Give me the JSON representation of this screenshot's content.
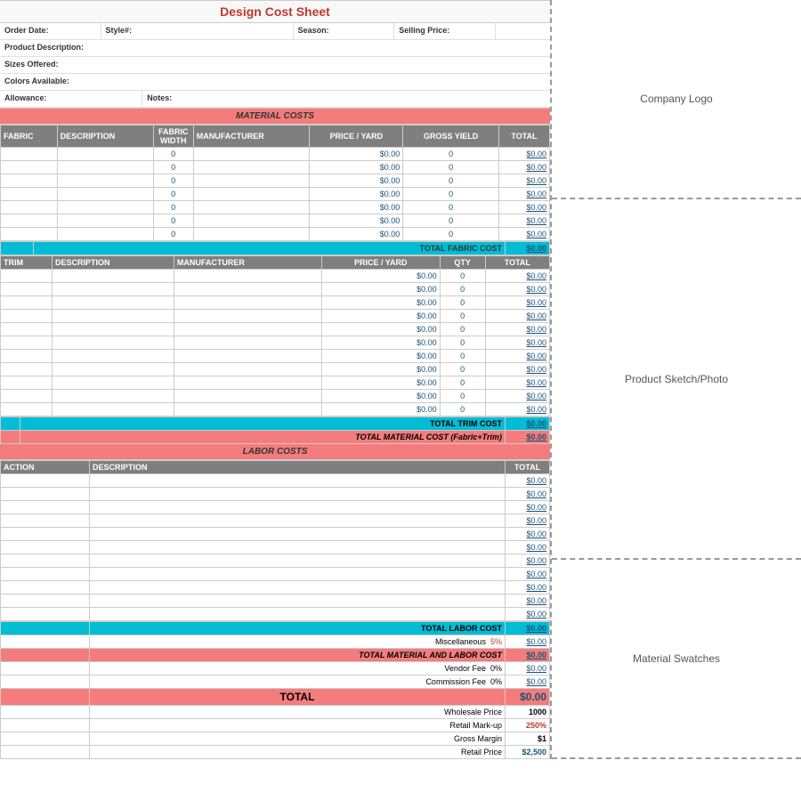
{
  "title": "Design Cost Sheet",
  "info": {
    "order_date_label": "Order Date:",
    "style_label": "Style#:",
    "season_label": "Season:",
    "selling_price_label": "Selling Price:",
    "product_desc_label": "Product Description:",
    "sizes_label": "Sizes Offered:",
    "colors_label": "Colors Available:",
    "allowance_label": "Allowance:",
    "notes_label": "Notes:"
  },
  "material_costs_header": "MATERIAL COSTS",
  "fabric_headers": [
    "FABRIC",
    "DESCRIPTION",
    "FABRIC WIDTH",
    "MANUFACTURER",
    "PRICE / YARD",
    "GROSS YIELD",
    "TOTAL"
  ],
  "fabric_rows": [
    {
      "price": "$0.00",
      "yield": "0",
      "total": "$0.00"
    },
    {
      "price": "$0.00",
      "yield": "0",
      "total": "$0.00"
    },
    {
      "price": "$0.00",
      "yield": "0",
      "total": "$0.00"
    },
    {
      "price": "$0.00",
      "yield": "0",
      "total": "$0.00"
    },
    {
      "price": "$0.00",
      "yield": "0",
      "total": "$0.00"
    },
    {
      "price": "$0.00",
      "yield": "0",
      "total": "$0.00"
    },
    {
      "price": "$0.00",
      "yield": "0",
      "total": "$0.00"
    }
  ],
  "total_fabric_label": "TOTAL FABRIC COST",
  "total_fabric_value": "$0.00",
  "trim_headers": [
    "TRIM",
    "DESCRIPTION",
    "MANUFACTURER",
    "PRICE / YARD",
    "QTY",
    "TOTAL"
  ],
  "trim_rows": [
    {
      "price": "$0.00",
      "qty": "0",
      "total": "$0.00"
    },
    {
      "price": "$0.00",
      "qty": "0",
      "total": "$0.00"
    },
    {
      "price": "$0.00",
      "qty": "0",
      "total": "$0.00"
    },
    {
      "price": "$0.00",
      "qty": "0",
      "total": "$0.00"
    },
    {
      "price": "$0.00",
      "qty": "0",
      "total": "$0.00"
    },
    {
      "price": "$0.00",
      "qty": "0",
      "total": "$0.00"
    },
    {
      "price": "$0.00",
      "qty": "0",
      "total": "$0.00"
    },
    {
      "price": "$0.00",
      "qty": "0",
      "total": "$0.00"
    },
    {
      "price": "$0.00",
      "qty": "0",
      "total": "$0.00"
    },
    {
      "price": "$0.00",
      "qty": "0",
      "total": "$0.00"
    },
    {
      "price": "$0.00",
      "qty": "0",
      "total": "$0.00"
    }
  ],
  "total_trim_label": "TOTAL TRIM COST",
  "total_trim_value": "$0.00",
  "total_material_label": "TOTAL MATERIAL COST (Fabric+Trim)",
  "total_material_value": "$0.00",
  "labor_costs_header": "LABOR COSTS",
  "labor_headers": [
    "ACTION",
    "DESCRIPTION",
    "TOTAL"
  ],
  "labor_rows": [
    {
      "total": "$0.00"
    },
    {
      "total": "$0.00"
    },
    {
      "total": "$0.00"
    },
    {
      "total": "$0.00"
    },
    {
      "total": "$0.00"
    },
    {
      "total": "$0.00"
    },
    {
      "total": "$0.00"
    },
    {
      "total": "$0.00"
    },
    {
      "total": "$0.00"
    },
    {
      "total": "$0.00"
    },
    {
      "total": "$0.00"
    }
  ],
  "total_labor_label": "TOTAL LABOR COST",
  "total_labor_value": "$0.00",
  "misc_label": "Miscellaneous",
  "misc_pct": "5%",
  "misc_value": "$0.00",
  "total_mat_labor_label": "TOTAL MATERIAL AND LABOR COST",
  "total_mat_labor_value": "$0.00",
  "vendor_fee_label": "Vendor Fee",
  "vendor_fee_pct": "0%",
  "vendor_fee_value": "$0.00",
  "commission_fee_label": "Commission Fee",
  "commission_fee_pct": "0%",
  "commission_fee_value": "$0.00",
  "grand_total_label": "TOTAL",
  "grand_total_value": "$0.00",
  "wholesale_label": "Wholesale Price",
  "wholesale_value": "1000",
  "retail_markup_label": "Retail Mark-up",
  "retail_markup_value": "250%",
  "gross_margin_label": "Gross Margin",
  "gross_margin_value": "$1",
  "retail_price_label": "Retail Price",
  "retail_price_value": "$2,500",
  "right_panel": {
    "logo_text": "Company Logo",
    "sketch_text": "Product Sketch/Photo",
    "swatches_text": "Material Swatches"
  }
}
